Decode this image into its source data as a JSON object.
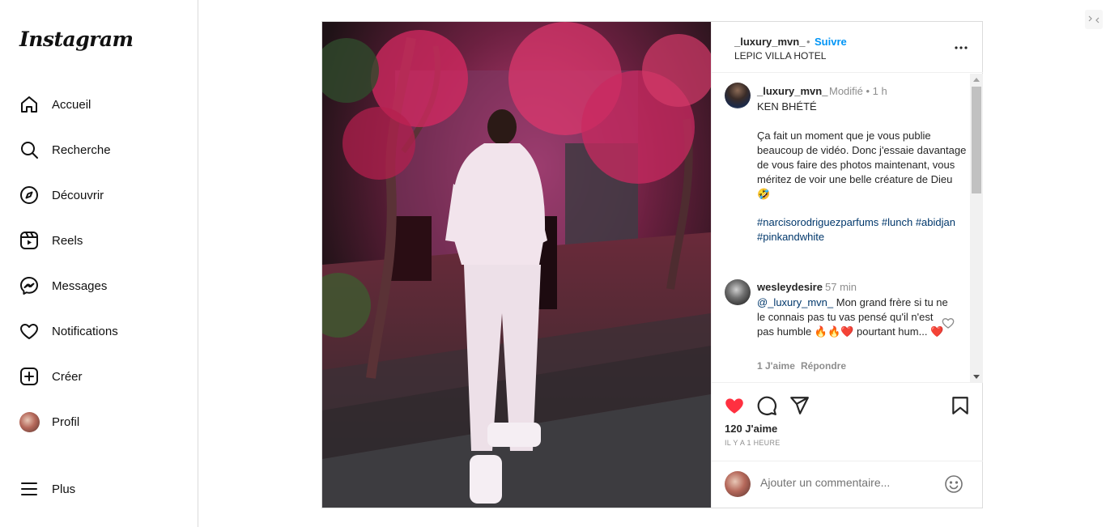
{
  "app": {
    "logo_text": "Instagram"
  },
  "sidebar": {
    "items": [
      {
        "label": "Accueil",
        "icon": "home-icon"
      },
      {
        "label": "Recherche",
        "icon": "search-icon"
      },
      {
        "label": "Découvrir",
        "icon": "compass-icon"
      },
      {
        "label": "Reels",
        "icon": "reels-icon"
      },
      {
        "label": "Messages",
        "icon": "messenger-icon"
      },
      {
        "label": "Notifications",
        "icon": "heart-icon"
      },
      {
        "label": "Créer",
        "icon": "plus-square-icon"
      },
      {
        "label": "Profil",
        "icon": "avatar"
      }
    ],
    "more_label": "Plus"
  },
  "post": {
    "header": {
      "username": "_luxury_mvn_",
      "separator": "•",
      "follow_label": "Suivre",
      "location": "LEPIC VILLA HOTEL"
    },
    "caption": {
      "username": "_luxury_mvn_",
      "meta": "Modifié •  1 h",
      "title": "KEN BHÉTÉ",
      "body": "Ça fait un moment que je vous publie beaucoup de vidéo. Donc j'essaie davantage de vous faire des photos maintenant, vous méritez de voir une belle créature de Dieu 🤣",
      "hashtags": "#narcisorodriguezparfums #lunch #abidjan #pinkandwhite"
    },
    "comment": {
      "username": "wesleydesire",
      "time": "57 min",
      "mention": "@_luxury_mvn_",
      "text": " Mon grand frère si tu ne le connais pas tu vas pensé qu'il n'est pas humble 🔥🔥❤️ pourtant hum... ❤️",
      "likes": "1 J'aime",
      "reply_label": "Répondre"
    },
    "likes_count": "120 J'aime",
    "time_ago": "IL Y A 1 HEURE",
    "add_comment": {
      "placeholder": "Ajouter un commentaire..."
    },
    "colors": {
      "like_red": "#ff3040",
      "follow_blue": "#0095f6",
      "hashtag_blue": "#00376b"
    }
  }
}
